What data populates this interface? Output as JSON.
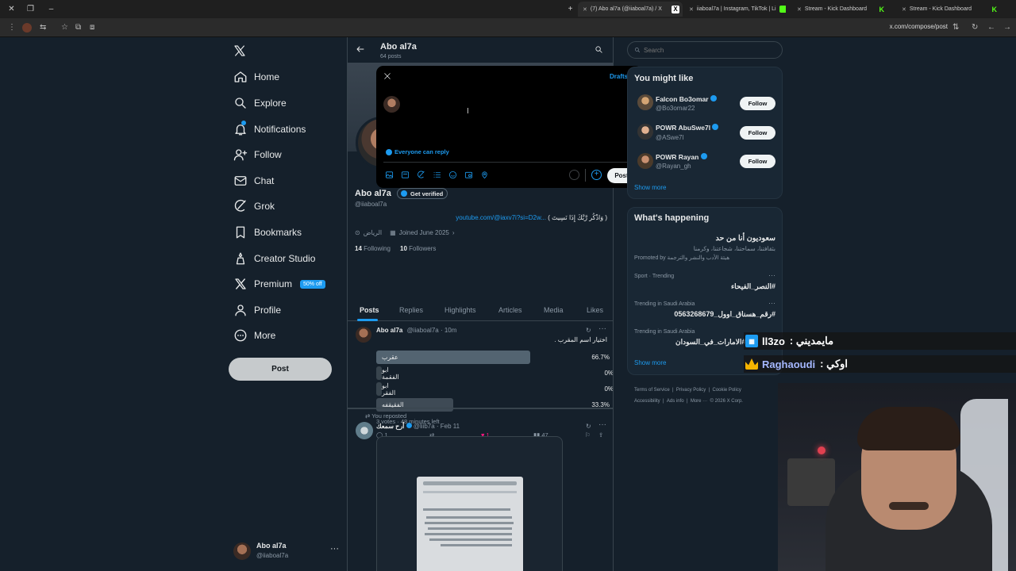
{
  "browser": {
    "tabs": [
      {
        "label": "(7) Abo al7a (@iiaboal7a) / X",
        "active": true
      },
      {
        "label": "iiaboal7a | Instagram, TikTok | Li"
      },
      {
        "label": "Stream - Kick Dashboard"
      },
      {
        "label": "Stream - Kick Dashboard"
      }
    ],
    "url": "x.com/compose/post"
  },
  "nav": {
    "items": [
      {
        "label": "Home",
        "icon": "home-icon"
      },
      {
        "label": "Explore",
        "icon": "search-icon"
      },
      {
        "label": "Notifications",
        "icon": "bell-icon"
      },
      {
        "label": "Follow",
        "icon": "person-plus-icon"
      },
      {
        "label": "Chat",
        "icon": "mail-icon"
      },
      {
        "label": "Grok",
        "icon": "grok-icon"
      },
      {
        "label": "Bookmarks",
        "icon": "bookmark-icon"
      },
      {
        "label": "Creator Studio",
        "icon": "creator-studio-icon"
      },
      {
        "label": "Premium",
        "icon": "x-logo-icon"
      },
      {
        "label": "Profile",
        "icon": "person-icon"
      },
      {
        "label": "More",
        "icon": "more-circle-icon"
      }
    ],
    "premium_badge": "50% off",
    "post_button": "Post",
    "account": {
      "name": "Abo al7a",
      "handle": "@iiaboal7a"
    }
  },
  "profile": {
    "name": "Abo al7a",
    "posts_count": "64 posts",
    "get_verified": "Get verified",
    "handle": "@iiaboal7a",
    "bio": "( وَاذْكُر رَّبَّكَ إِذَا نَسِيتَ )",
    "bio_link": "youtube.com/@iaxv7i?si=D2w...",
    "location": "الرياض",
    "joined": "Joined June 2025",
    "following_count": "14",
    "following_label": "Following",
    "followers_count": "10",
    "followers_label": "Followers",
    "tabs": [
      "Posts",
      "Replies",
      "Highlights",
      "Articles",
      "Media",
      "Likes"
    ]
  },
  "post1": {
    "author": "Abo al7a",
    "handle_time": "@iiaboal7a · 10m",
    "text": "اختيار اسم المقرب .",
    "poll": [
      {
        "label": "عقرب",
        "pct": "66.7%",
        "fraction": 0.667
      },
      {
        "label": "ابو الفقمة",
        "pct": "0%",
        "fraction": 0
      },
      {
        "label": "ابو الفقر",
        "pct": "0%",
        "fraction": 0
      },
      {
        "label": "الفقيقفه",
        "pct": "33.3%",
        "fraction": 0.333
      }
    ],
    "poll_meta": "3 votes · 48 minutes left",
    "replies": "1",
    "likes": "1",
    "views": "47"
  },
  "post2": {
    "repost_label": "You reposted",
    "author": "أرح سمعك",
    "handle_time": "@liib7a · Feb 11"
  },
  "search": {
    "placeholder": "Search"
  },
  "who_to_follow": {
    "title": "You might like",
    "users": [
      {
        "name": "Falcon Bo3omar",
        "handle": "@Bo3omar22",
        "follow": "Follow"
      },
      {
        "name": "POWR AbuSwe7l",
        "handle": "@ASwe7l",
        "follow": "Follow"
      },
      {
        "name": "POWR Rayan",
        "handle": "@Rayan_gh",
        "follow": "Follow"
      }
    ],
    "show_more": "Show more"
  },
  "happening": {
    "title": "What's happening",
    "items": [
      {
        "meta": "",
        "title": "سعوديون أنا من حد",
        "sub": "بثقافتنا، سماحتنا، شجاعتنا، وكرمنا",
        "promo": "Promoted by هيئة الأدب والنشر والترجمة"
      },
      {
        "meta": "Sport · Trending",
        "title": "#النصر_الفيحاء"
      },
      {
        "meta": "Trending in Saudi Arabia",
        "title": "#رقم_هسناق_اوول_0563268679"
      },
      {
        "meta": "Trending in Saudi Arabia",
        "title": "#الامارات_في_السودان"
      }
    ],
    "show_more": "Show more"
  },
  "footer": {
    "links": [
      "Terms of Service",
      "Privacy Policy",
      "Cookie Policy",
      "Accessibility",
      "Ads info",
      "More ···",
      "© 2026 X Corp."
    ]
  },
  "compose": {
    "drafts": "Drafts",
    "typed_text": "با",
    "reply_setting": "Everyone can reply",
    "post_button": "Post"
  },
  "chat_overlay": [
    {
      "user": "ll3zo",
      "message": "مايمديني :"
    },
    {
      "user": "Raghaoudi",
      "message": "اوكي :"
    }
  ],
  "colors": {
    "accent": "#1d9bf0",
    "background": "#15202b",
    "kick_green": "#53fc18"
  }
}
